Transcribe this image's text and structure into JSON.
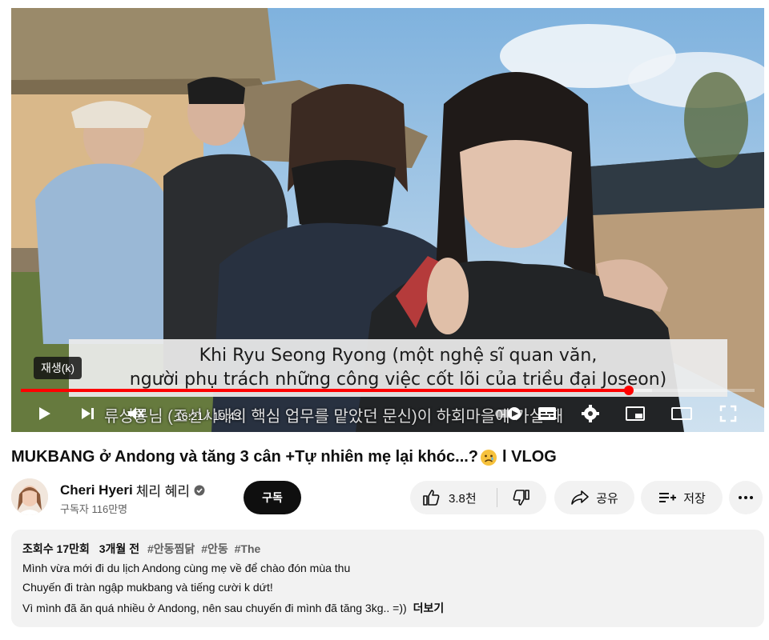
{
  "player": {
    "chapter_chip": "재생(k)",
    "subtitle_line1": "Khi Ryu Seong Ryong (một nghệ sĩ quan văn,",
    "subtitle_line2": "người phụ trách những công việc cốt lõi của triều đại Joseon)",
    "korean_subtitle": "류성룡님 (조선시대의 핵심 업무를 맡았던 문신)이 하회마을에 가실 때",
    "time_current": "16:21",
    "time_total": "19:43",
    "progress_fraction": 0.829,
    "buffered_fraction": 0.86,
    "icons": [
      "play-icon",
      "next-icon",
      "volume-icon",
      "autoplay-toggle-icon",
      "subtitles-icon",
      "settings-icon",
      "miniplayer-icon",
      "theater-icon",
      "fullscreen-icon"
    ],
    "accent_color": "#ff0000"
  },
  "video": {
    "title": "MUKBANG ở Andong và tăng 3 cân +Tự nhiên mẹ lại khóc...?",
    "title_suffix": "l VLOG",
    "title_emoji": "sad-face-emoji"
  },
  "channel": {
    "name": "Cheri Hyeri",
    "name_korean": "체리 혜리",
    "subscribers": "구독자 116만명",
    "verified": true,
    "subscribe_label": "구독"
  },
  "actions": {
    "like_count": "3.8천",
    "share_label": "공유",
    "save_label": "저장"
  },
  "description": {
    "views": "조회수 17만회",
    "date": "3개월 전",
    "tags": [
      "#안동찜닭",
      "#안동",
      "#The"
    ],
    "lines": [
      "Mình vừa mới đi du lịch Andong cùng mẹ về để chào đón mùa thu",
      "Chuyến đi tràn ngập mukbang và tiếng cười k dứt!",
      "Vì mình đã ăn quá nhiều ở Andong, nên sau chuyến đi mình đã tăng 3kg.. =))"
    ],
    "more_label": "더보기"
  }
}
